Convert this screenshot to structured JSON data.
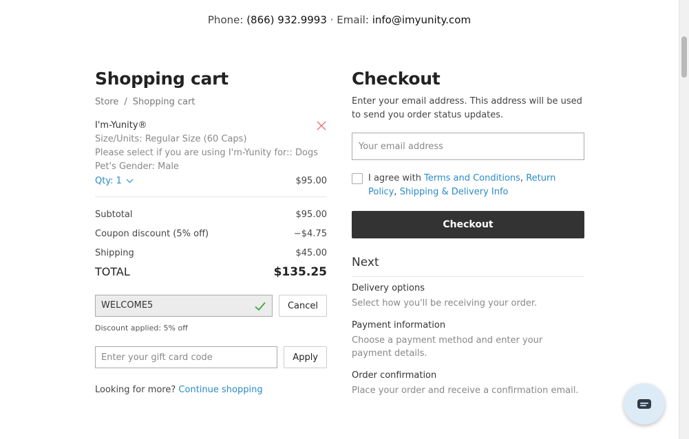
{
  "topbar": {
    "phone_label": "Phone:",
    "phone": "(866) 932.9993",
    "separator": "·",
    "email_label": "Email:",
    "email": "info@imyunity.com"
  },
  "cart": {
    "title": "Shopping cart",
    "breadcrumb": [
      "Store",
      "/",
      "Shopping cart"
    ],
    "item": {
      "name": "I'm-Yunity®",
      "options": [
        "Size/Units: Regular Size (60 Caps)",
        "Please select if you are using I'm-Yunity for:: Dogs",
        "Pet's Gender: Male"
      ],
      "qty_label": "Qty: 1",
      "price": "$95.00"
    },
    "summary": [
      {
        "label": "Subtotal",
        "value": "$95.00"
      },
      {
        "label": "Coupon discount (5% off)",
        "value": "−$4.75"
      },
      {
        "label": "Shipping",
        "value": "$45.00"
      }
    ],
    "total": {
      "label": "TOTAL",
      "value": "$135.25"
    },
    "coupon": {
      "code": "WELCOME5",
      "cancel_label": "Cancel",
      "note": "Discount applied: 5% off"
    },
    "gift": {
      "placeholder": "Enter your gift card code",
      "apply_label": "Apply"
    },
    "more": {
      "text": "Looking for more?",
      "link": "Continue shopping"
    }
  },
  "checkout": {
    "title": "Checkout",
    "description": "Enter your email address. This address will be used to send you order status updates.",
    "email_placeholder": "Your email address",
    "agree": {
      "prefix": "I agree with",
      "terms": "Terms and Conditions",
      "comma1": ",",
      "returns": "Return Policy",
      "comma2": ",",
      "shipping": "Shipping & Delivery Info"
    },
    "button_label": "Checkout",
    "next_title": "Next",
    "steps": [
      {
        "title": "Delivery options",
        "desc": "Select how you'll be receiving your order."
      },
      {
        "title": "Payment information",
        "desc": "Choose a payment method and enter your payment details."
      },
      {
        "title": "Order confirmation",
        "desc": "Place your order and receive a confirmation email."
      }
    ]
  },
  "colors": {
    "link": "#2b8bc6",
    "button": "#333333",
    "remove": "#e07070",
    "check": "#3aa33a",
    "chat_bg": "#dcebf6"
  },
  "icons": {
    "remove": "close-icon",
    "qty": "chevron-down-icon",
    "coupon": "checkmark-icon",
    "chat": "chat-icon"
  }
}
